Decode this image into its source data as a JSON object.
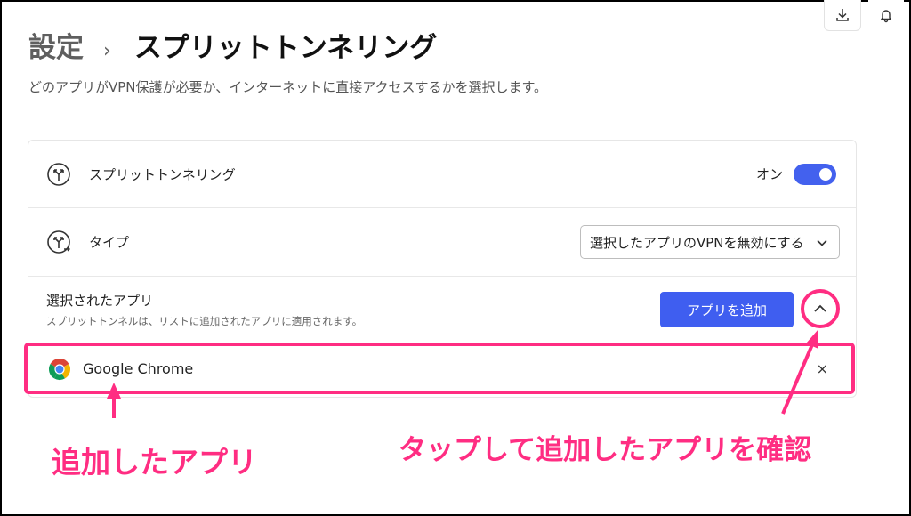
{
  "breadcrumb": {
    "parent": "設定",
    "separator": "›",
    "current": "スプリットトンネリング"
  },
  "subtitle": "どのアプリがVPN保護が必要か、インターネットに直接アクセスするかを選択します。",
  "split_tunneling": {
    "label": "スプリットトンネリング",
    "state": "オン",
    "enabled": true
  },
  "type": {
    "label": "タイプ",
    "selected": "選択したアプリのVPNを無効にする"
  },
  "selected_apps": {
    "title": "選択されたアプリ",
    "description": "スプリットトンネルは、リストに追加されたアプリに適用されます。",
    "add_button": "アプリを追加",
    "apps": [
      {
        "name": "Google Chrome",
        "remove": "×"
      }
    ]
  },
  "annotations": {
    "added_app": "追加したアプリ",
    "tap_to_check": "タップして追加したアプリを確認"
  },
  "colors": {
    "accent": "#3f5ef0",
    "annotation": "#ff2d82"
  },
  "icons": {
    "download": "download-icon",
    "bell": "bell-icon",
    "split": "split-tunnel-icon",
    "type": "type-icon",
    "chrome": "chrome-icon"
  }
}
